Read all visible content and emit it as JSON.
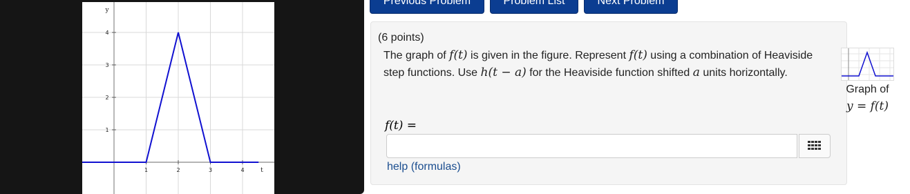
{
  "nav": {
    "previous_label": "Previous Problem",
    "list_label": "Problem List",
    "next_label": "Next Problem"
  },
  "figure": {
    "y_axis_label": "y",
    "x_axis_label": "t",
    "x_ticks": [
      "1",
      "2",
      "3",
      "4"
    ],
    "y_ticks": [
      "1",
      "2",
      "3",
      "4"
    ]
  },
  "problem": {
    "points": "(6 points)",
    "text_1": "The graph of ",
    "math_ft_1": "f(t)",
    "text_2": " is given in the figure. Represent ",
    "math_ft_2": "f(t)",
    "text_3": " using a combination of Heaviside step functions. Use ",
    "math_h": "h(t − a)",
    "text_4": " for the Heaviside function shifted ",
    "math_a": "a",
    "text_5": " units horizontally.",
    "answer_label": "f(t) =",
    "answer_value": "",
    "help_label": "help (formulas)"
  },
  "thumbnail": {
    "caption_line1": "Graph of",
    "caption_line2": "y = f(t)"
  },
  "icons": {
    "keyboard": "grid-keyboard-icon"
  },
  "chart_data": {
    "type": "line",
    "xlabel": "t",
    "ylabel": "y",
    "xlim": [
      -1,
      4.5
    ],
    "ylim": [
      -0.2,
      4.5
    ],
    "x": [
      -1,
      1,
      2,
      3,
      4.5
    ],
    "y": [
      0,
      0,
      4,
      0,
      0
    ],
    "grid": true
  },
  "colors": {
    "nav_button": "#0b3d91",
    "graph_line": "#1010d0",
    "link": "#1a4d8f"
  }
}
